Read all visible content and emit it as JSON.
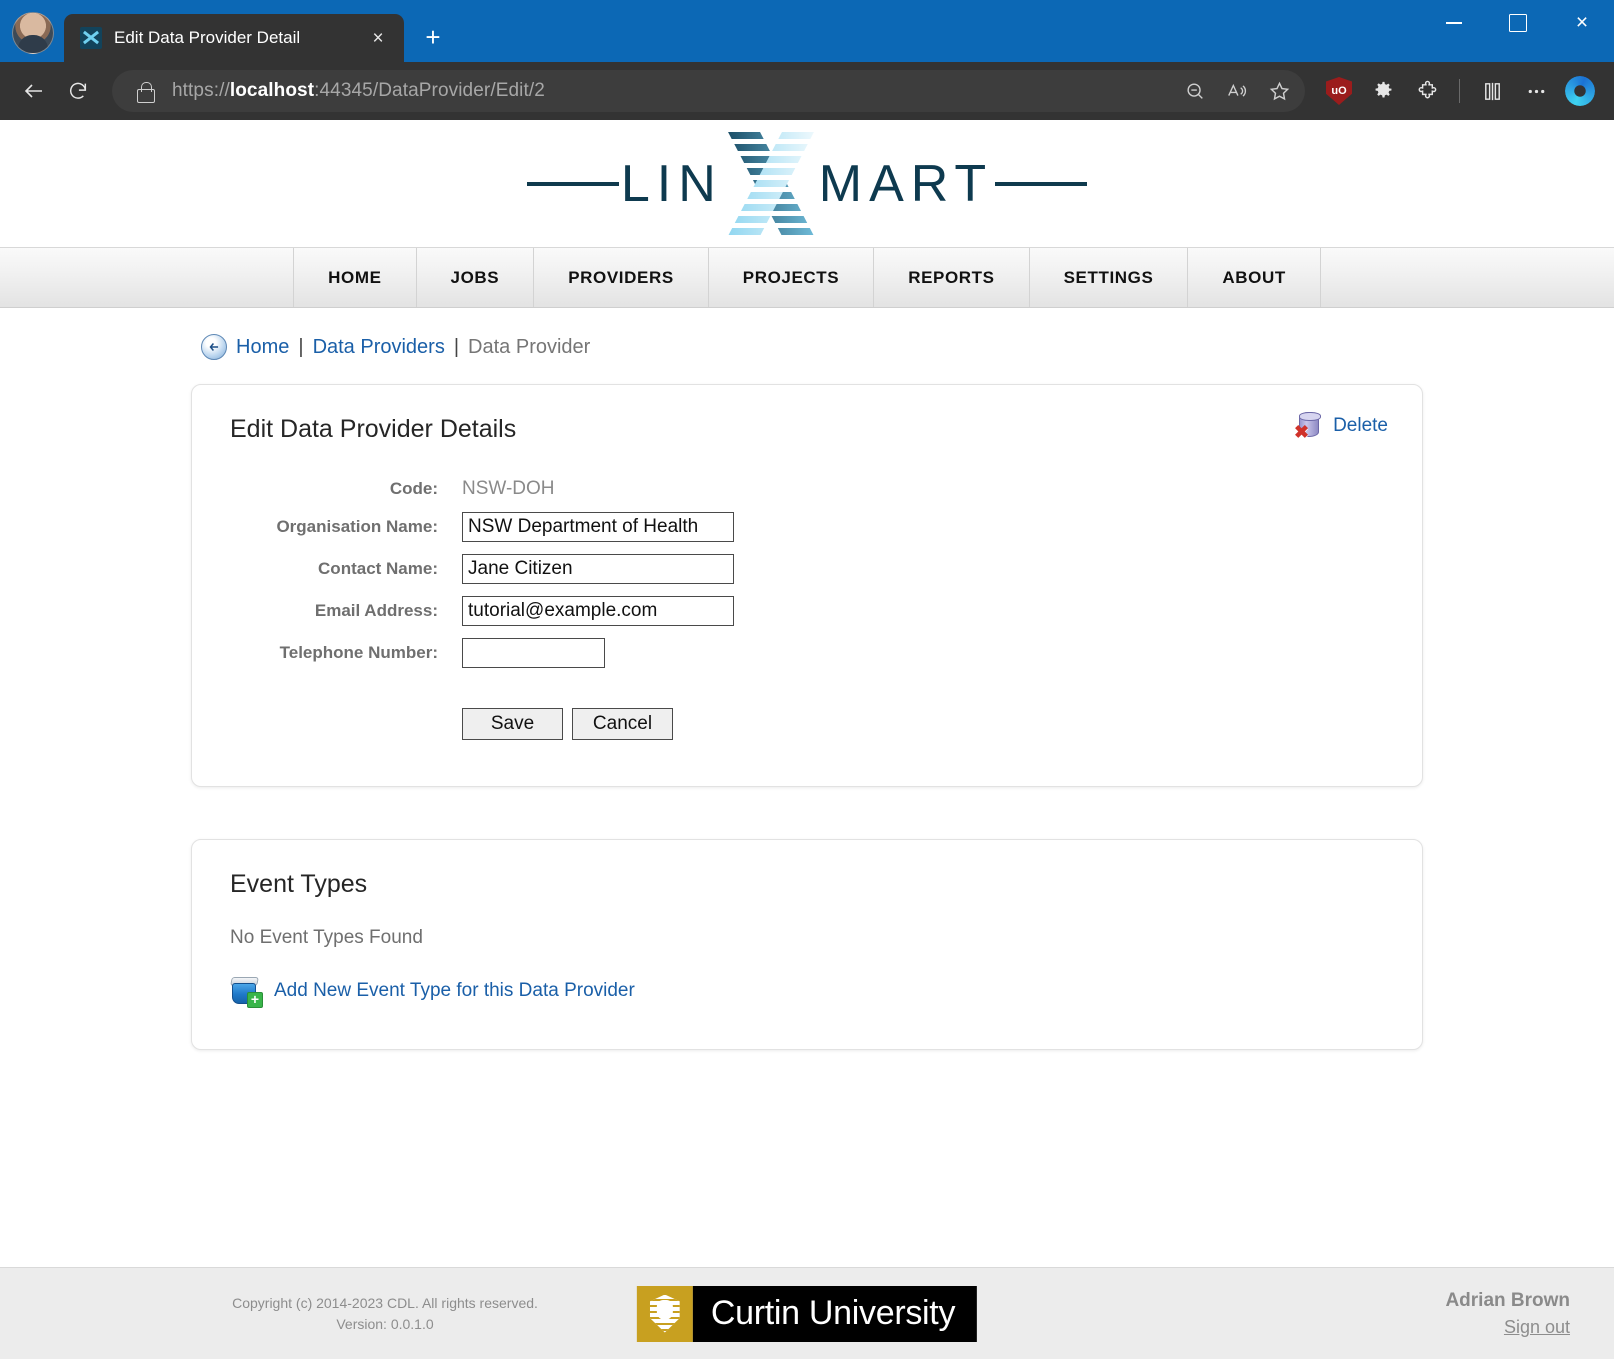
{
  "browser": {
    "tab": {
      "title": "Edit Data Provider Detail",
      "favicon": "linxmart-x-icon",
      "close_label": "×"
    },
    "new_tab_label": "+",
    "window_controls": {
      "minimize": "—",
      "maximize": "□",
      "close": "×"
    },
    "nav": {
      "back": "←",
      "reload": "↻"
    },
    "address": {
      "scheme": "https://",
      "host": "localhost",
      "rest": ":44345/DataProvider/Edit/2",
      "full_url": "https://localhost:44345/DataProvider/Edit/2",
      "lock_icon": "lock-icon"
    },
    "toolbar_icons": [
      {
        "name": "zoom-out-icon",
        "glyph": "⊖"
      },
      {
        "name": "read-aloud-icon",
        "glyph": "A"
      },
      {
        "name": "favorite-star-icon",
        "glyph": "☆"
      },
      {
        "name": "ublock-origin-icon",
        "glyph": "uO"
      },
      {
        "name": "settings-gear-icon",
        "glyph": "⚙"
      },
      {
        "name": "extensions-puzzle-icon",
        "glyph": "❖"
      },
      {
        "name": "split-screen-icon",
        "glyph": "◫"
      },
      {
        "name": "more-options-icon",
        "glyph": "⋯"
      },
      {
        "name": "copilot-icon",
        "glyph": ""
      }
    ]
  },
  "site": {
    "logo": {
      "left_text": "LIN",
      "right_text": "MART",
      "alt": "LINXMART"
    },
    "nav_items": [
      {
        "label": "HOME"
      },
      {
        "label": "JOBS"
      },
      {
        "label": "PROVIDERS"
      },
      {
        "label": "PROJECTS"
      },
      {
        "label": "REPORTS"
      },
      {
        "label": "SETTINGS"
      },
      {
        "label": "ABOUT"
      }
    ]
  },
  "breadcrumb": {
    "back_glyph": "←",
    "home": "Home",
    "sep1": "|",
    "data_providers": "Data Providers",
    "sep2": "|",
    "current": "Data Provider"
  },
  "provider_card": {
    "title": "Edit Data Provider Details",
    "delete_label": "Delete",
    "delete_icon": "database-delete-icon",
    "fields": [
      {
        "label": "Code:",
        "type": "static",
        "value": "NSW-DOH"
      },
      {
        "label": "Organisation Name:",
        "type": "input",
        "value": "NSW Department of Health",
        "placeholder": ""
      },
      {
        "label": "Contact Name:",
        "type": "input",
        "value": "Jane Citizen",
        "placeholder": ""
      },
      {
        "label": "Email Address:",
        "type": "input",
        "value": "tutorial@example.com",
        "placeholder": ""
      },
      {
        "label": "Telephone Number:",
        "type": "input",
        "value": "",
        "placeholder": ""
      }
    ],
    "save_label": "Save",
    "cancel_label": "Cancel"
  },
  "event_types_card": {
    "title": "Event Types",
    "empty_message": "No Event Types Found",
    "add_label": "Add New Event Type for this Data Provider",
    "add_icon": "add-database-icon"
  },
  "footer": {
    "copyright_line1": "Copyright (c) 2014-2023 CDL. All rights reserved.",
    "copyright_line2": "Version: 0.0.1.0",
    "partner_logo_text": "Curtin University",
    "user_name": "Adrian Brown",
    "sign_out": "Sign out"
  },
  "colors": {
    "titlebar": "#0c68b5",
    "chrome": "#333333",
    "link": "#1a5fa8",
    "muted": "#6f6f6f",
    "brand_dark": "#0e3a4f",
    "brand_light": "#4fb6e0",
    "curtin_gold": "#c8a020"
  }
}
